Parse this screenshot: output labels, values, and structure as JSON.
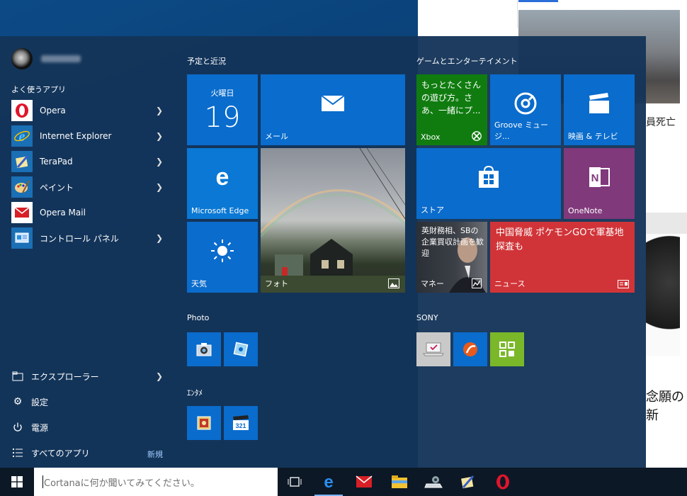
{
  "user": {
    "name": ""
  },
  "left": {
    "section_title": "よく使うアプリ",
    "apps": [
      {
        "label": "Opera",
        "icon": "opera-icon"
      },
      {
        "label": "Internet Explorer",
        "icon": "ie-icon"
      },
      {
        "label": "TeraPad",
        "icon": "terapad-icon"
      },
      {
        "label": "ペイント",
        "icon": "paint-icon"
      },
      {
        "label": "Opera  Mail",
        "icon": "opera-mail-icon"
      },
      {
        "label": "コントロール パネル",
        "icon": "control-panel-icon"
      }
    ],
    "bottom": {
      "explorer": "エクスプローラー",
      "settings": "設定",
      "power": "電源",
      "all_apps": "すべてのアプリ",
      "new": "新規"
    }
  },
  "groups": {
    "schedule": "予定と近況",
    "games": "ゲームとエンターテイメント",
    "photo": "Photo",
    "sony": "SONY",
    "entame": "ｴﾝﾀﾒ"
  },
  "tiles": {
    "calendar_day": "火曜日",
    "calendar_date": "19",
    "mail": "メール",
    "edge": "Microsoft Edge",
    "photos": "フォト",
    "weather": "天気",
    "xbox_text": "もっとたくさんの遊び方。さあ、一緒にプ...",
    "xbox": "Xbox",
    "groove": "Groove ミュージ...",
    "movies": "映画 & テレビ",
    "store": "ストア",
    "onenote": "OneNote",
    "money_text": "英財務相、SBの企業買収計画を歓迎",
    "money": "マネー",
    "news_text": "中国脅威 ポケモンGOで軍基地探査も",
    "news": "ニュース"
  },
  "browser": {
    "headline1": "員死亡",
    "headline2": "念願の新"
  },
  "taskbar": {
    "search_placeholder": "Cortanaに何か聞いてみてください。"
  },
  "colors": {
    "tile_blue": "#0a6ccc",
    "xbox_green": "#107c10",
    "onenote_purple": "#80397b",
    "news_red": "#d13438",
    "sony_green": "#7ab82a"
  }
}
